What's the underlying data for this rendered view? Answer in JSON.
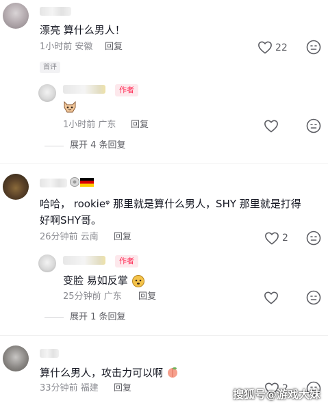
{
  "comments": [
    {
      "text": "漂亮  算什么男人！",
      "time": "1小时前",
      "location": "安徽",
      "reply_label": "回复",
      "like_count": "22",
      "badge": "首评",
      "reply": {
        "author_badge": "作者",
        "time": "1小时前",
        "location": "广东",
        "reply_label": "回复"
      },
      "expand_label": "展开 4 条回复"
    },
    {
      "text_line1": "哈哈， rookieᵠ 那里就是算什么男人，SHY 那里就是打得",
      "text_line2": "好啊SHY哥。",
      "time": "26分钟前",
      "location": "云南",
      "reply_label": "回复",
      "like_count": "2",
      "reply": {
        "author_badge": "作者",
        "text": "变脸 易如反掌",
        "time": "25分钟前",
        "location": "广东",
        "reply_label": "回复"
      },
      "expand_label": "展开 1 条回复"
    },
    {
      "text": "算什么男人，攻击力可以啊",
      "time": "33分钟前",
      "location": "福建",
      "reply_label": "回复",
      "like_count": "2"
    }
  ],
  "watermark": "搜狐号@游戏大妹",
  "colors": {
    "accent": "#fe2c55",
    "meta": "#8a8b91",
    "text": "#161823"
  },
  "icons": [
    "heart-icon",
    "dislike-face-icon",
    "emoji-sticker-icon",
    "flag-icon"
  ]
}
